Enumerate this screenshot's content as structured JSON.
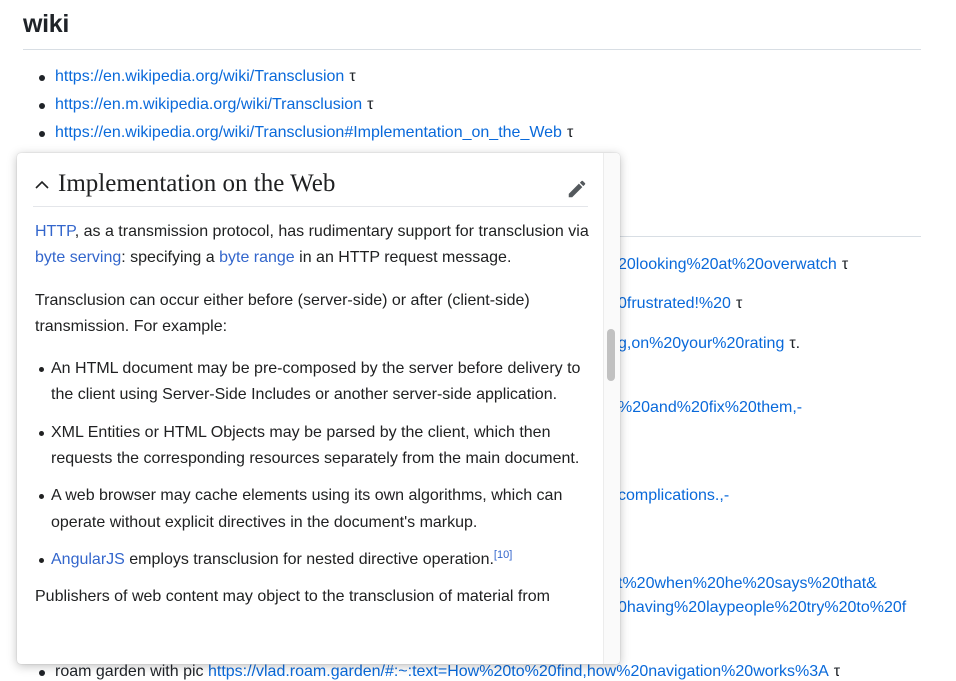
{
  "page": {
    "heading": "wiki",
    "tau": "τ",
    "links": [
      "https://en.wikipedia.org/wiki/Transclusion",
      "https://en.m.wikipedia.org/wiki/Transclusion",
      "https://en.wikipedia.org/wiki/Transclusion#Implementation_on_the_Web"
    ],
    "bg_fragments": [
      "20looking%20at%20overwatch",
      "0frustrated!%20",
      "g,on%20your%20rating",
      "%20and%20fix%20them,-",
      "complications.,-",
      "t%20when%20he%20says%20that&",
      "0having%20laypeople%20try%20to%20f"
    ],
    "bottom_item": {
      "prefix": "roam garden with pic ",
      "link": "https://vlad.roam.garden/#:~:text=How%20to%20find,how%20navigation%20works%3A"
    }
  },
  "popup": {
    "title": "Implementation on the Web",
    "p1": {
      "link1": "HTTP",
      "t1": ", as a transmission protocol, has rudimentary support for transclusion via ",
      "link2": "byte serving",
      "t2": ": specifying a ",
      "link3": "byte range",
      "t3": " in an HTTP request message."
    },
    "p2": "Transclusion can occur either before (server-side) or after (client-side) transmission. For example:",
    "bullets": [
      "An HTML document may be pre-composed by the server before delivery to the client using Server-Side Includes or another server-side application.",
      "XML Entities or HTML Objects may be parsed by the client, which then requests the corresponding resources separately from the main document.",
      "A web browser may cache elements using its own algorithms, which can operate without explicit directives in the document's markup."
    ],
    "bullet4": {
      "link": "AngularJS",
      "text": " employs transclusion for nested directive operation.",
      "ref": "[10]"
    },
    "p3": "Publishers of web content may object to the transclusion of material from"
  },
  "icons": {
    "collapse": "chevron-up-icon",
    "edit": "pencil-icon"
  },
  "colors": {
    "link": "#0969da",
    "wiki_link": "#3366cc",
    "text": "#1f2328"
  }
}
